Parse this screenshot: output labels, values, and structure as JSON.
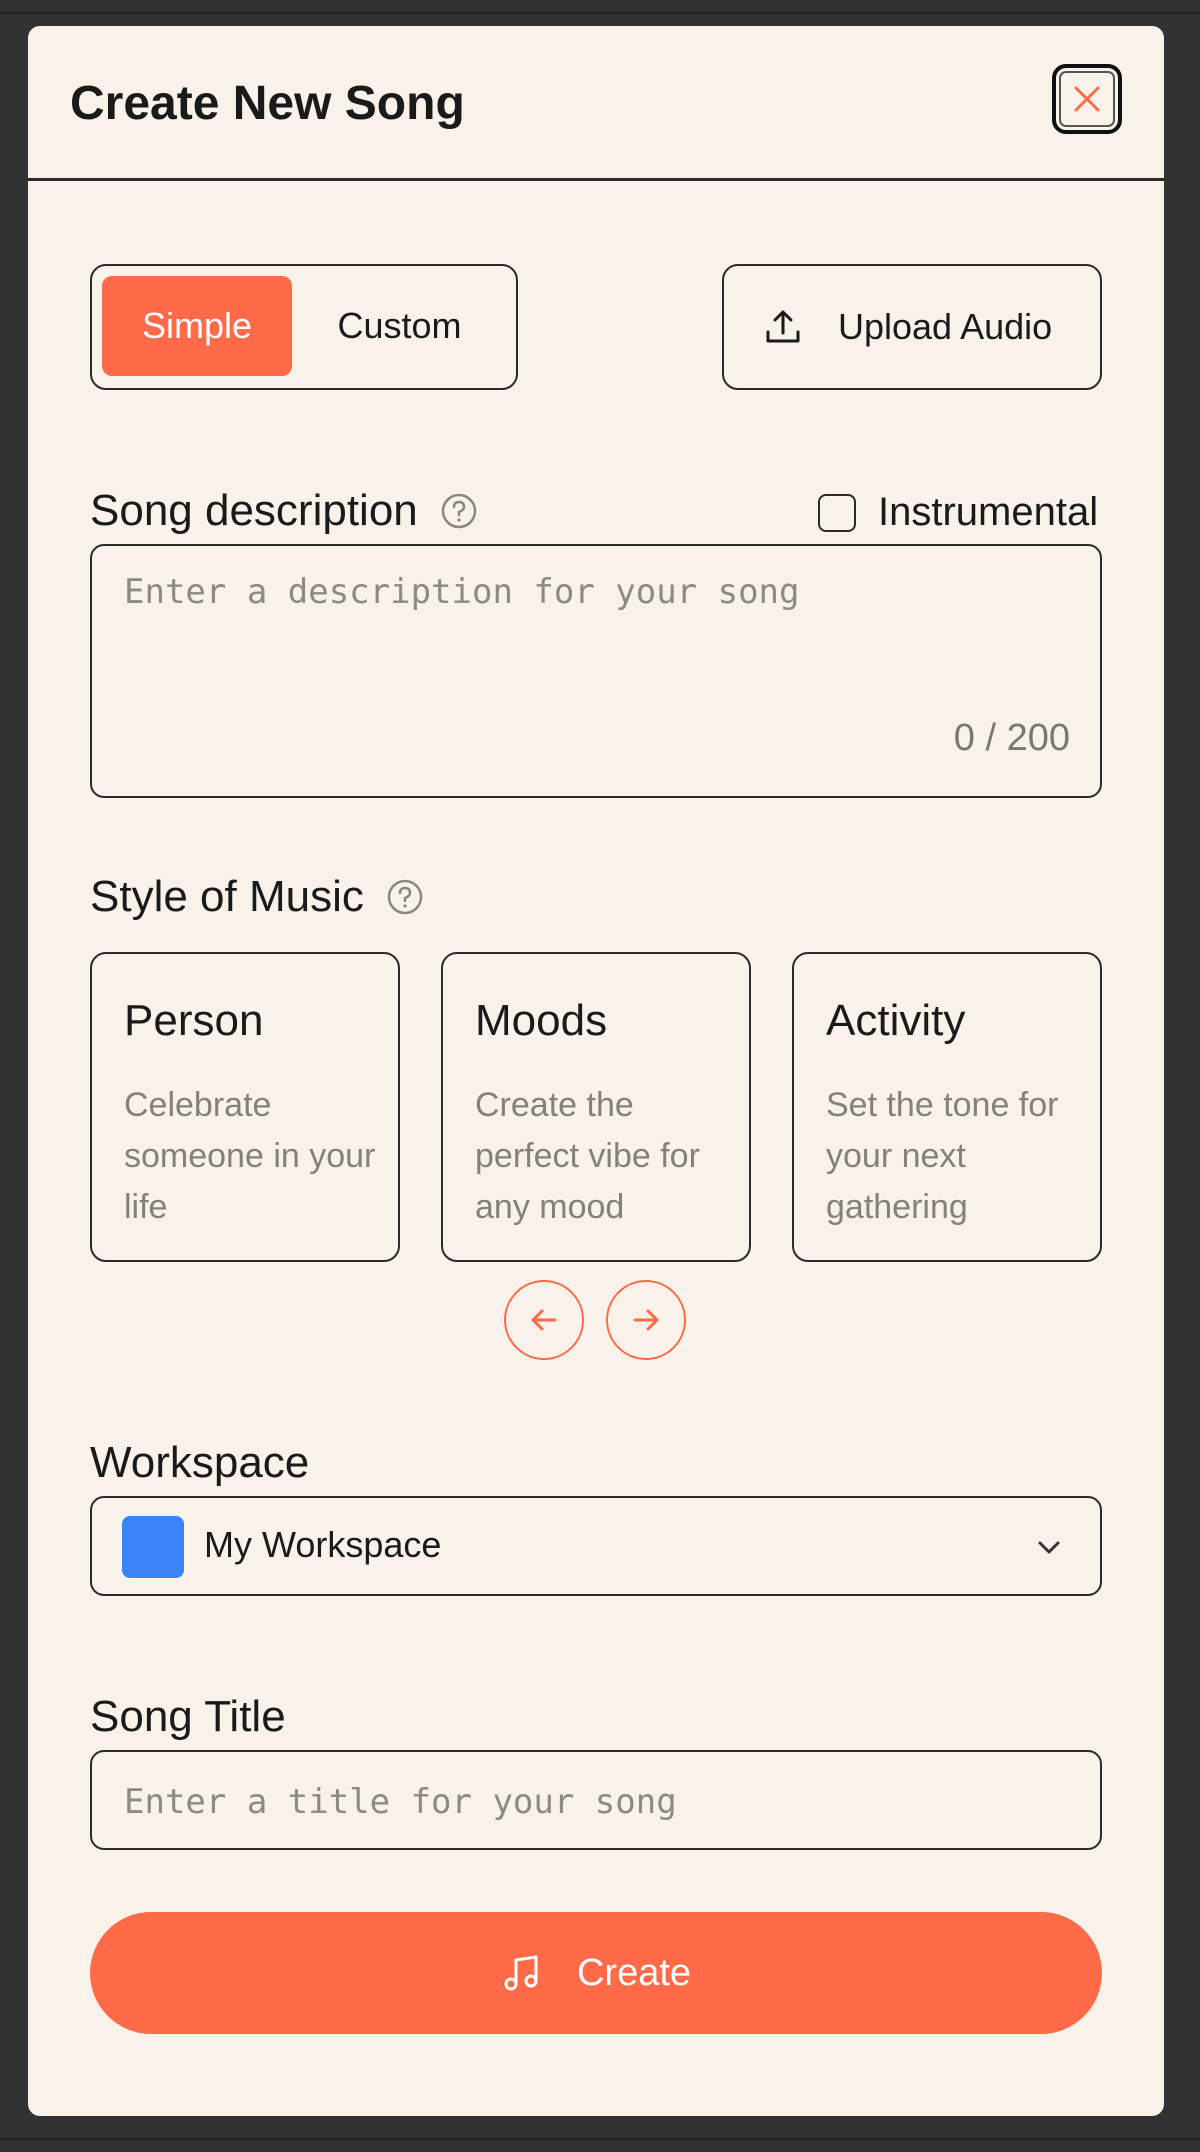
{
  "dialog": {
    "title": "Create New Song",
    "close_icon": "close-icon"
  },
  "mode_toggle": {
    "options": [
      "Simple",
      "Custom"
    ],
    "selected": "Simple"
  },
  "upload": {
    "label": "Upload Audio",
    "icon": "upload-icon"
  },
  "description": {
    "label": "Song description",
    "help_icon": "help-icon",
    "placeholder": "Enter a description for your song",
    "value": "",
    "counter": "0 / 200"
  },
  "instrumental": {
    "label": "Instrumental",
    "checked": false
  },
  "style": {
    "label": "Style of Music",
    "help_icon": "help-icon",
    "cards": [
      {
        "title": "Person",
        "description": "Celebrate someone in your life"
      },
      {
        "title": "Moods",
        "description": "Create the perfect vibe for any mood"
      },
      {
        "title": "Activity",
        "description": "Set the tone for your next gathering"
      }
    ],
    "prev_icon": "arrow-left-icon",
    "next_icon": "arrow-right-icon"
  },
  "workspace": {
    "label": "Workspace",
    "selected": "My Workspace",
    "swatch_color": "#3b82f6",
    "chevron_icon": "chevron-down-icon"
  },
  "song_title": {
    "label": "Song Title",
    "placeholder": "Enter a title for your song",
    "value": ""
  },
  "create": {
    "label": "Create",
    "icon": "music-note-icon"
  },
  "colors": {
    "accent": "#ff6a48",
    "background": "#f8f2ea",
    "overlay": "#323232"
  }
}
